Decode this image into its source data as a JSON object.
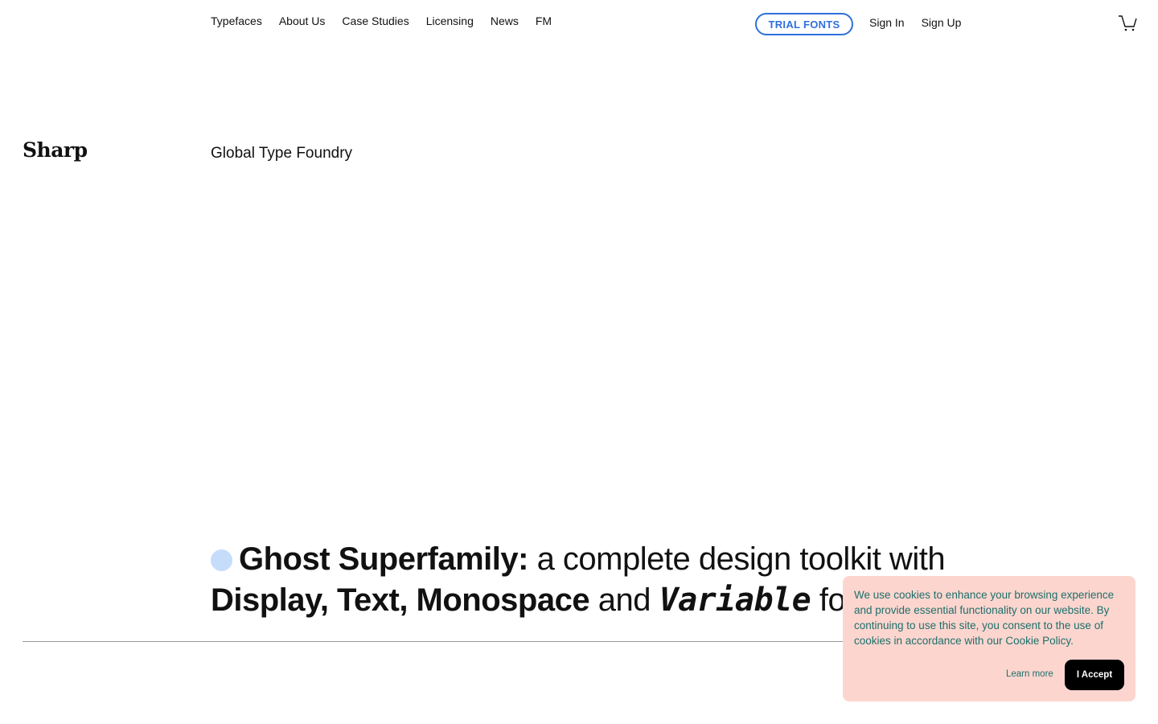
{
  "nav": {
    "items": [
      {
        "label": "Typefaces"
      },
      {
        "label": "About Us"
      },
      {
        "label": "Case Studies"
      },
      {
        "label": "Licensing"
      },
      {
        "label": "News"
      },
      {
        "label": "FM"
      }
    ],
    "trial_label": "TRIAL FONTS",
    "sign_in": "Sign In",
    "sign_up": "Sign Up",
    "cart_icon": "cart-icon"
  },
  "brand": {
    "logo": "Sharp",
    "tagline": "Global Type Foundry"
  },
  "hero": {
    "strong1": "Ghost Superfamily:",
    "text1": " a complete design toolkit with",
    "strong2": "Display, Text, Monospace",
    "text2": " and ",
    "mono": "Variable",
    "text3": " font styles"
  },
  "cookie": {
    "message": "We use cookies to enhance your browsing experience and provide essential functionality on our website. By continuing to use this site, you consent to the use of cookies in accordance with our Cookie Policy.",
    "learn_more": "Learn more",
    "accept": "I Accept"
  },
  "colors": {
    "accent_blue": "#2f6fdc",
    "dot_blue": "#c6dcfb",
    "cookie_bg": "#fdd5cf",
    "cookie_text": "#1d6f6a"
  }
}
